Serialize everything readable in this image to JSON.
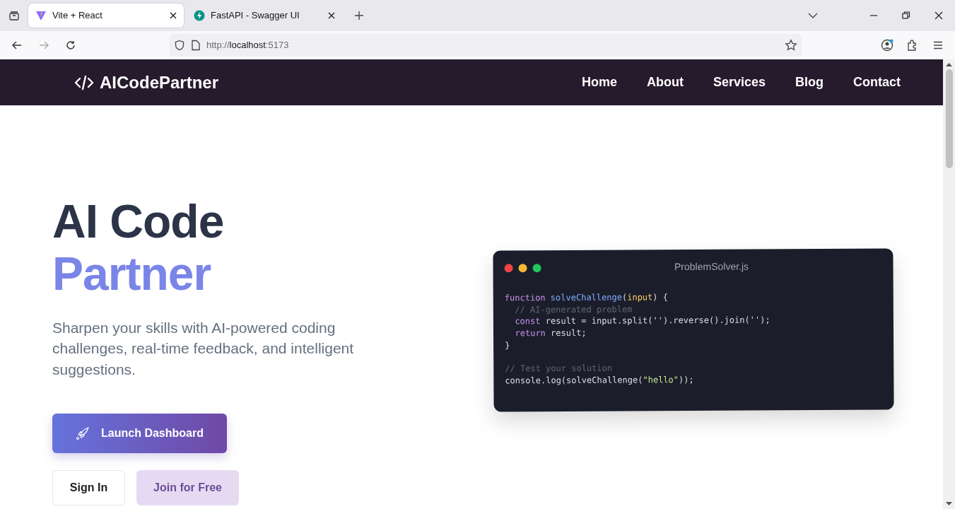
{
  "browser": {
    "tabs": [
      {
        "title": "Vite + React",
        "selected": true
      },
      {
        "title": "FastAPI - Swagger UI",
        "selected": false
      }
    ],
    "address": {
      "scheme": "http://",
      "host": "localhost",
      "port": ":5173"
    }
  },
  "navbar": {
    "brand": "AICodePartner",
    "links": [
      {
        "label": "Home"
      },
      {
        "label": "About"
      },
      {
        "label": "Services"
      },
      {
        "label": "Blog"
      },
      {
        "label": "Contact"
      }
    ]
  },
  "hero": {
    "title_line_1": "AI Code",
    "title_line_2": "Partner",
    "subtitle": "Sharpen your skills with AI-powered coding challenges, real-time feedback, and intelligent suggestions.",
    "primary_button": "Launch Dashboard",
    "secondary_buttons": [
      {
        "label": "Sign In",
        "kind": "outline"
      },
      {
        "label": "Join for Free",
        "kind": "soft"
      }
    ]
  },
  "code_window": {
    "dots": [
      {
        "color": "#ef4444"
      },
      {
        "color": "#f5b731"
      },
      {
        "color": "#22c55e"
      }
    ],
    "filename": "ProblemSolver.js",
    "lines": [
      [
        {
          "text": "function ",
          "kind": "keyword"
        },
        {
          "text": "solveChallenge",
          "kind": "function"
        },
        {
          "text": "(",
          "kind": "plain"
        },
        {
          "text": "input",
          "kind": "param"
        },
        {
          "text": ") {",
          "kind": "plain"
        }
      ],
      [
        {
          "text": "  // AI-generated problem",
          "kind": "comment"
        }
      ],
      [
        {
          "text": "  const ",
          "kind": "keyword"
        },
        {
          "text": "result = input.split('').reverse().join('');",
          "kind": "plain"
        }
      ],
      [
        {
          "text": "  return ",
          "kind": "keyword"
        },
        {
          "text": "result;",
          "kind": "plain"
        }
      ],
      [
        {
          "text": "}",
          "kind": "plain"
        }
      ],
      [
        {
          "text": "// Test your solution",
          "kind": "comment",
          "blank_before": true
        }
      ],
      [
        {
          "text": "console.log(solveChallenge(",
          "kind": "plain"
        },
        {
          "text": "\"hello\"",
          "kind": "string"
        },
        {
          "text": "));",
          "kind": "plain"
        }
      ]
    ]
  }
}
